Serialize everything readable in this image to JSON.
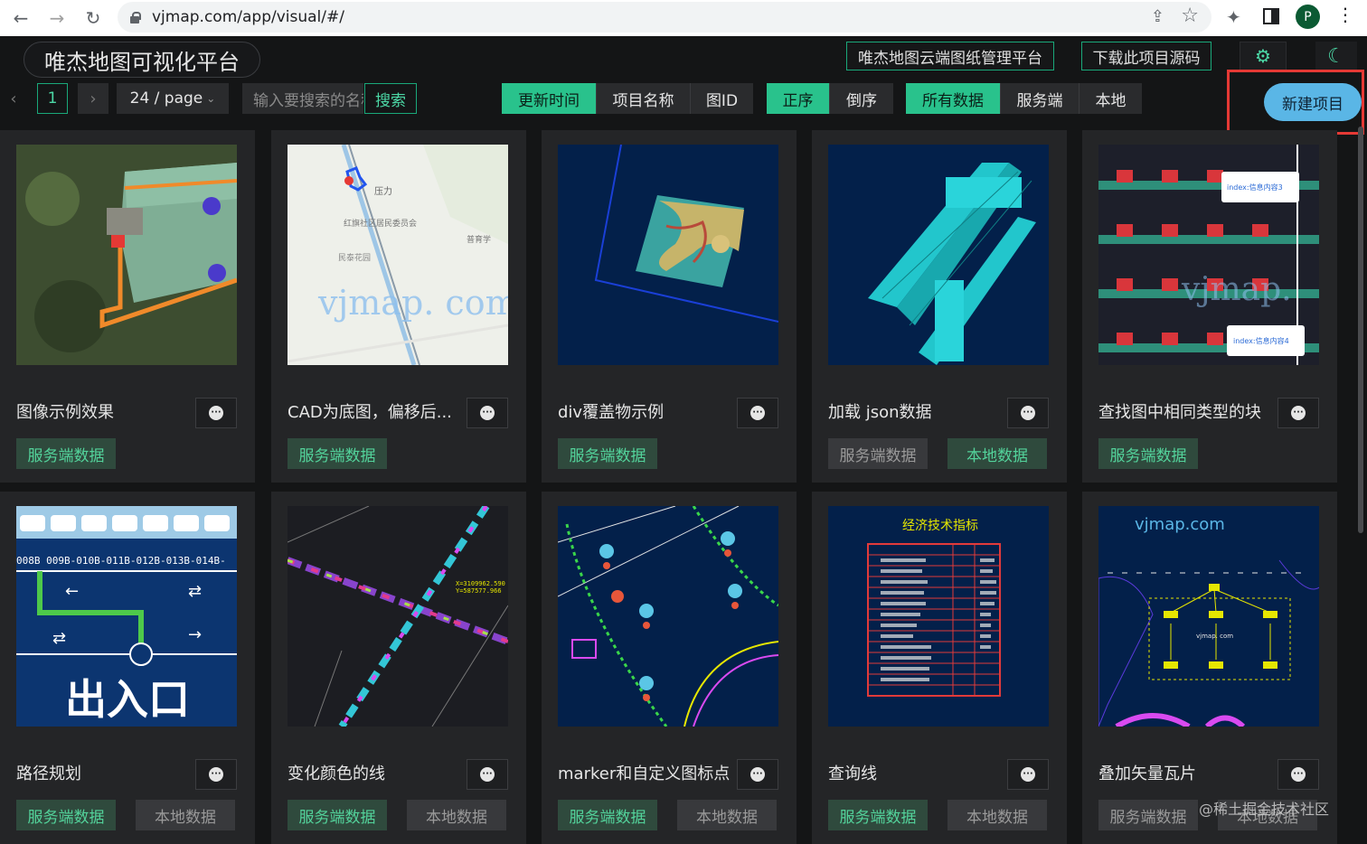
{
  "browser": {
    "url": "vjmap.com/app/visual/#/",
    "profile_initial": "P"
  },
  "header": {
    "title": "唯杰地图可视化平台",
    "cloud_btn": "唯杰地图云端图纸管理平台",
    "download_btn": "下载此项目源码"
  },
  "toolbar": {
    "page_number": "1",
    "page_size": "24 / page",
    "search_placeholder": "输入要搜索的名称",
    "search_btn": "搜索",
    "sort_fields": [
      "更新时间",
      "项目名称",
      "图ID"
    ],
    "sort_order": [
      "正序",
      "倒序"
    ],
    "data_source": [
      "所有数据",
      "服务端",
      "本地"
    ],
    "new_project": "新建项目"
  },
  "colors": {
    "accent": "#29c28c",
    "new_button": "#5ab6e6",
    "highlight": "#e53935"
  },
  "cards": [
    {
      "name": "图像示例效果",
      "server": "服务端数据",
      "local": "",
      "server_active": true,
      "local_active": false
    },
    {
      "name": "CAD为底图，偏移后...",
      "server": "服务端数据",
      "local": "",
      "server_active": true,
      "local_active": false
    },
    {
      "name": "div覆盖物示例",
      "server": "服务端数据",
      "local": "",
      "server_active": true,
      "local_active": false
    },
    {
      "name": "加载 json数据",
      "server": "服务端数据",
      "local": "本地数据",
      "server_active": false,
      "local_active": true
    },
    {
      "name": "查找图中相同类型的块",
      "server": "服务端数据",
      "local": "",
      "server_active": true,
      "local_active": false
    },
    {
      "name": "路径规划",
      "server": "服务端数据",
      "local": "本地数据",
      "server_active": true,
      "local_active": false
    },
    {
      "name": "变化颜色的线",
      "server": "服务端数据",
      "local": "本地数据",
      "server_active": true,
      "local_active": false
    },
    {
      "name": "marker和自定义图标点",
      "server": "服务端数据",
      "local": "本地数据",
      "server_active": true,
      "local_active": false
    },
    {
      "name": "查询线",
      "server": "服务端数据",
      "local": "本地数据",
      "server_active": true,
      "local_active": false
    },
    {
      "name": "叠加矢量瓦片",
      "server": "服务端数据",
      "local": "本地数据",
      "server_active": false,
      "local_active": false
    }
  ],
  "thumb_text": {
    "t2_watermark": "vjmap. com",
    "t2_label1": "红旗社区居民委员会",
    "t2_label2": "普育学",
    "t2_label3": "民泰花园",
    "t5_popup1": "index:信息内容3",
    "t5_popup2": "index:信息内容4",
    "t5_watermark": "vjmap.",
    "t6_big": "出入口",
    "t6_row": "008B 009B-010B-011B-012B-013B-014B-",
    "t7_coord1": "X=3109962.590",
    "t7_coord2": "Y=587577.966",
    "t9_title": "经济技术指标",
    "t10_title": "vjmap.com",
    "t10_sub": "vjmap. com"
  },
  "watermark": "@稀土掘金技术社区"
}
